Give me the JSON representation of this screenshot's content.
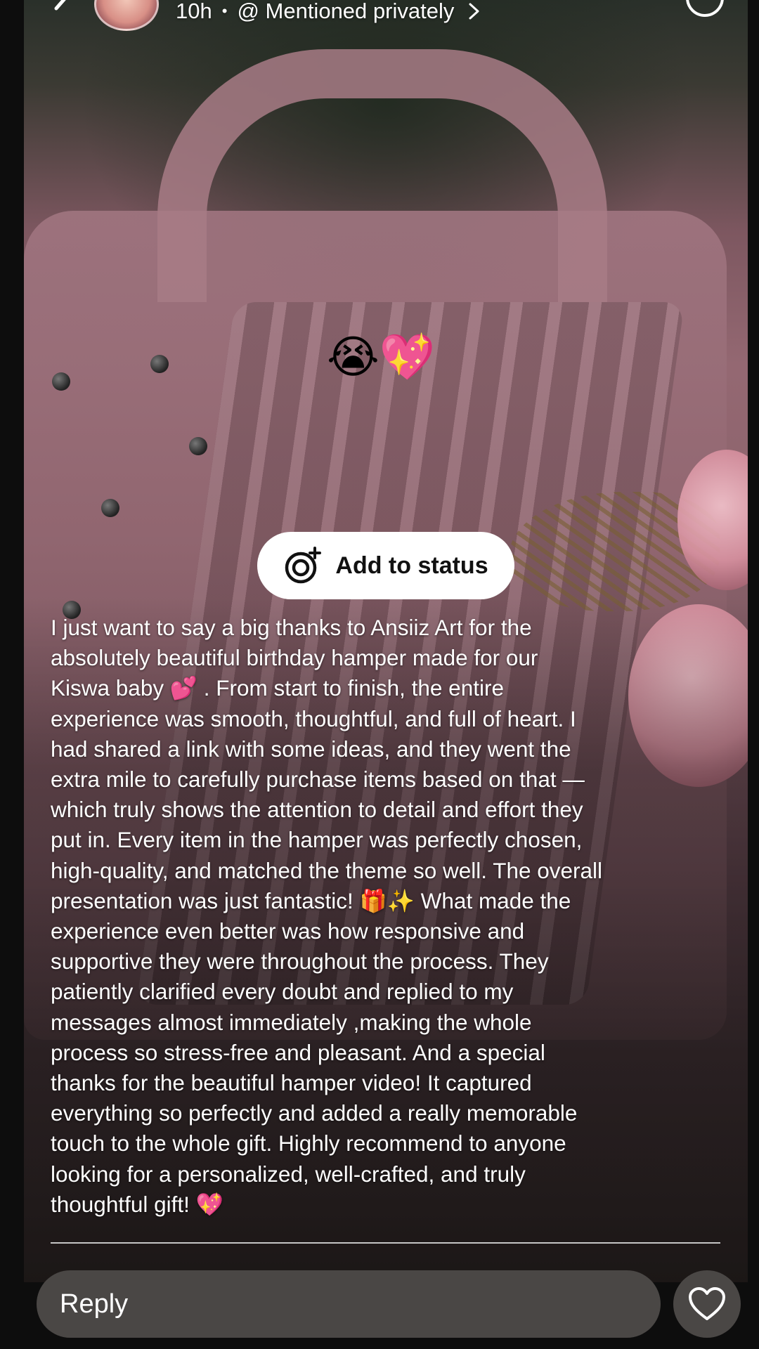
{
  "header": {
    "time_ago": "10h",
    "separator": "•",
    "mention_label": "@ Mentioned privately",
    "icons": {
      "back": "chevron-left-icon",
      "avatar": "avatar",
      "chevron": "chevron-right-icon",
      "more": "more-icon"
    }
  },
  "sticker": {
    "emoji": "😭💖"
  },
  "add_status": {
    "label": "Add to status",
    "icon": "camera-plus-icon"
  },
  "caption": {
    "lines": [
      "I just want to say a big thanks to Ansiiz Art for the",
      "absolutely beautiful birthday hamper made for our",
      "Kiswa baby 💕 . From start to finish, the entire",
      "experience was smooth, thoughtful, and full of heart.  I",
      "had shared a link with some ideas, and they went the",
      "extra mile to carefully purchase items based on that —",
      "which truly shows the attention to detail and effort they",
      "put in. Every item in the hamper was perfectly chosen,",
      "high-quality, and matched the theme so well. The overall",
      "presentation was just fantastic! 🎁✨   What made the",
      "experience even better was how responsive and",
      "supportive they were throughout the process. They",
      "patiently clarified every doubt and replied to my",
      "messages almost immediately ,making the whole",
      "process so stress-free and pleasant.  And a special",
      "thanks for the beautiful hamper video! It captured",
      "everything so perfectly and added a really memorable",
      "touch to the whole gift.  Highly recommend to anyone",
      "looking for a personalized, well-crafted, and truly",
      "thoughtful gift! 💖"
    ]
  },
  "reply": {
    "placeholder": "Reply",
    "like_icon": "heart-icon"
  },
  "colors": {
    "button_bg": "#ffffff",
    "reply_bg": "#4a4745",
    "text": "#ffffff"
  }
}
